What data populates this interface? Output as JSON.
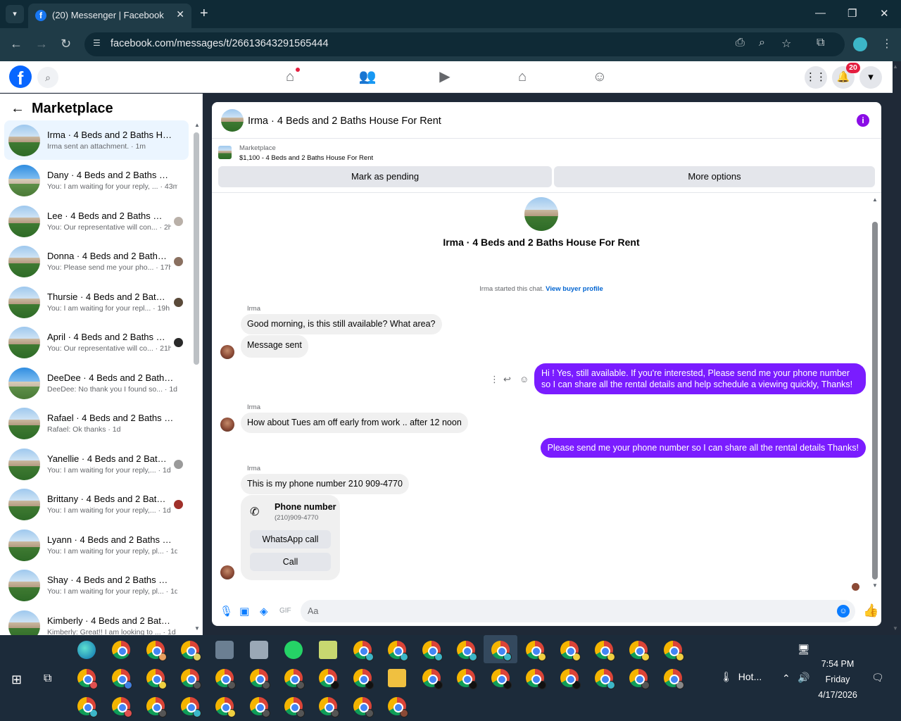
{
  "browser": {
    "tab_title": "(20) Messenger | Facebook",
    "url": "facebook.com/messages/t/26613643291565444"
  },
  "fb": {
    "notifications_count": "20"
  },
  "left_panel": {
    "title": "Marketplace",
    "conversations": [
      {
        "name": "Irma · 4 Beds and 2 Baths House For Rent",
        "snippet": "Irma sent an attachment. · 1m",
        "active": true
      },
      {
        "name": "Dany · 4 Beds and 2 Baths House For Rent",
        "snippet": "You: I am waiting for your reply, ... · 43m"
      },
      {
        "name": "Lee · 4 Beds and 2 Baths House For Rent",
        "snippet": "You: Our representative will con... · 2h"
      },
      {
        "name": "Donna · 4 Beds and 2 Baths House For Rent",
        "snippet": "You: Please send me your pho... · 17h"
      },
      {
        "name": "Thursie · 4 Beds and 2 Baths House For Rent",
        "snippet": "You: I am waiting for your repl... · 19h"
      },
      {
        "name": "April · 4 Beds and 2 Baths House For Rent",
        "snippet": "You: Our representative will co... · 21h"
      },
      {
        "name": "DeeDee · 4 Beds and 2 Baths House For Rent",
        "snippet": "DeeDee: No thank you I found so... · 1d"
      },
      {
        "name": "Rafael · 4 Beds and 2 Baths House For Rent",
        "snippet": "Rafael: Ok thanks · 1d"
      },
      {
        "name": "Yanellie · 4 Beds and 2 Baths House For Rent",
        "snippet": "You: I am waiting for your reply,... · 1d"
      },
      {
        "name": "Brittany · 4 Beds and 2 Baths House For Rent",
        "snippet": "You: I am waiting for your reply,... · 1d"
      },
      {
        "name": "Lyann · 4 Beds and 2 Baths House For Rent",
        "snippet": "You: I am waiting for your reply, pl... · 1d"
      },
      {
        "name": "Shay · 4 Beds and 2 Baths House For Rent",
        "snippet": "You: I am waiting for your reply, pl... · 1d"
      },
      {
        "name": "Kimberly · 4 Beds and 2 Baths House For Rent",
        "snippet": "Kimberly: Great!! I am looking to ... · 1d"
      }
    ]
  },
  "chat": {
    "title": "Irma · 4 Beds and 2 Baths House For Rent",
    "listing_label": "Marketplace",
    "listing_price": "$1,100 - 4 Beds and 2 Baths House For Rent",
    "mark_pending": "Mark as pending",
    "more_options": "More options",
    "big_title": "Irma · 4 Beds and 2 Baths House For Rent",
    "started_text": "Irma started this chat.",
    "view_buyer": "View buyer profile",
    "messages": {
      "sender": "Irma",
      "m1": "Good morning, is this still available? What area?",
      "m2": "Message sent",
      "m3": "Hi ! Yes, still available. If you're interested, Please send me your phone number so I can share all the rental details and help schedule a viewing quickly, Thanks!",
      "m4": "How about Tues am off early from work .. after 12 noon",
      "m5": "Please send me your phone number so I can share all the rental details Thanks!",
      "m6": "This is my phone number 210 909-4770"
    },
    "phone_card": {
      "label": "Phone number",
      "number": "(210)909-4770",
      "whatsapp": "WhatsApp call",
      "call": "Call"
    },
    "composer_placeholder": "Aa"
  },
  "taskbar": {
    "weather": "Hot...",
    "time": "7:54 PM",
    "day": "Friday",
    "date": "4/17/2026"
  }
}
